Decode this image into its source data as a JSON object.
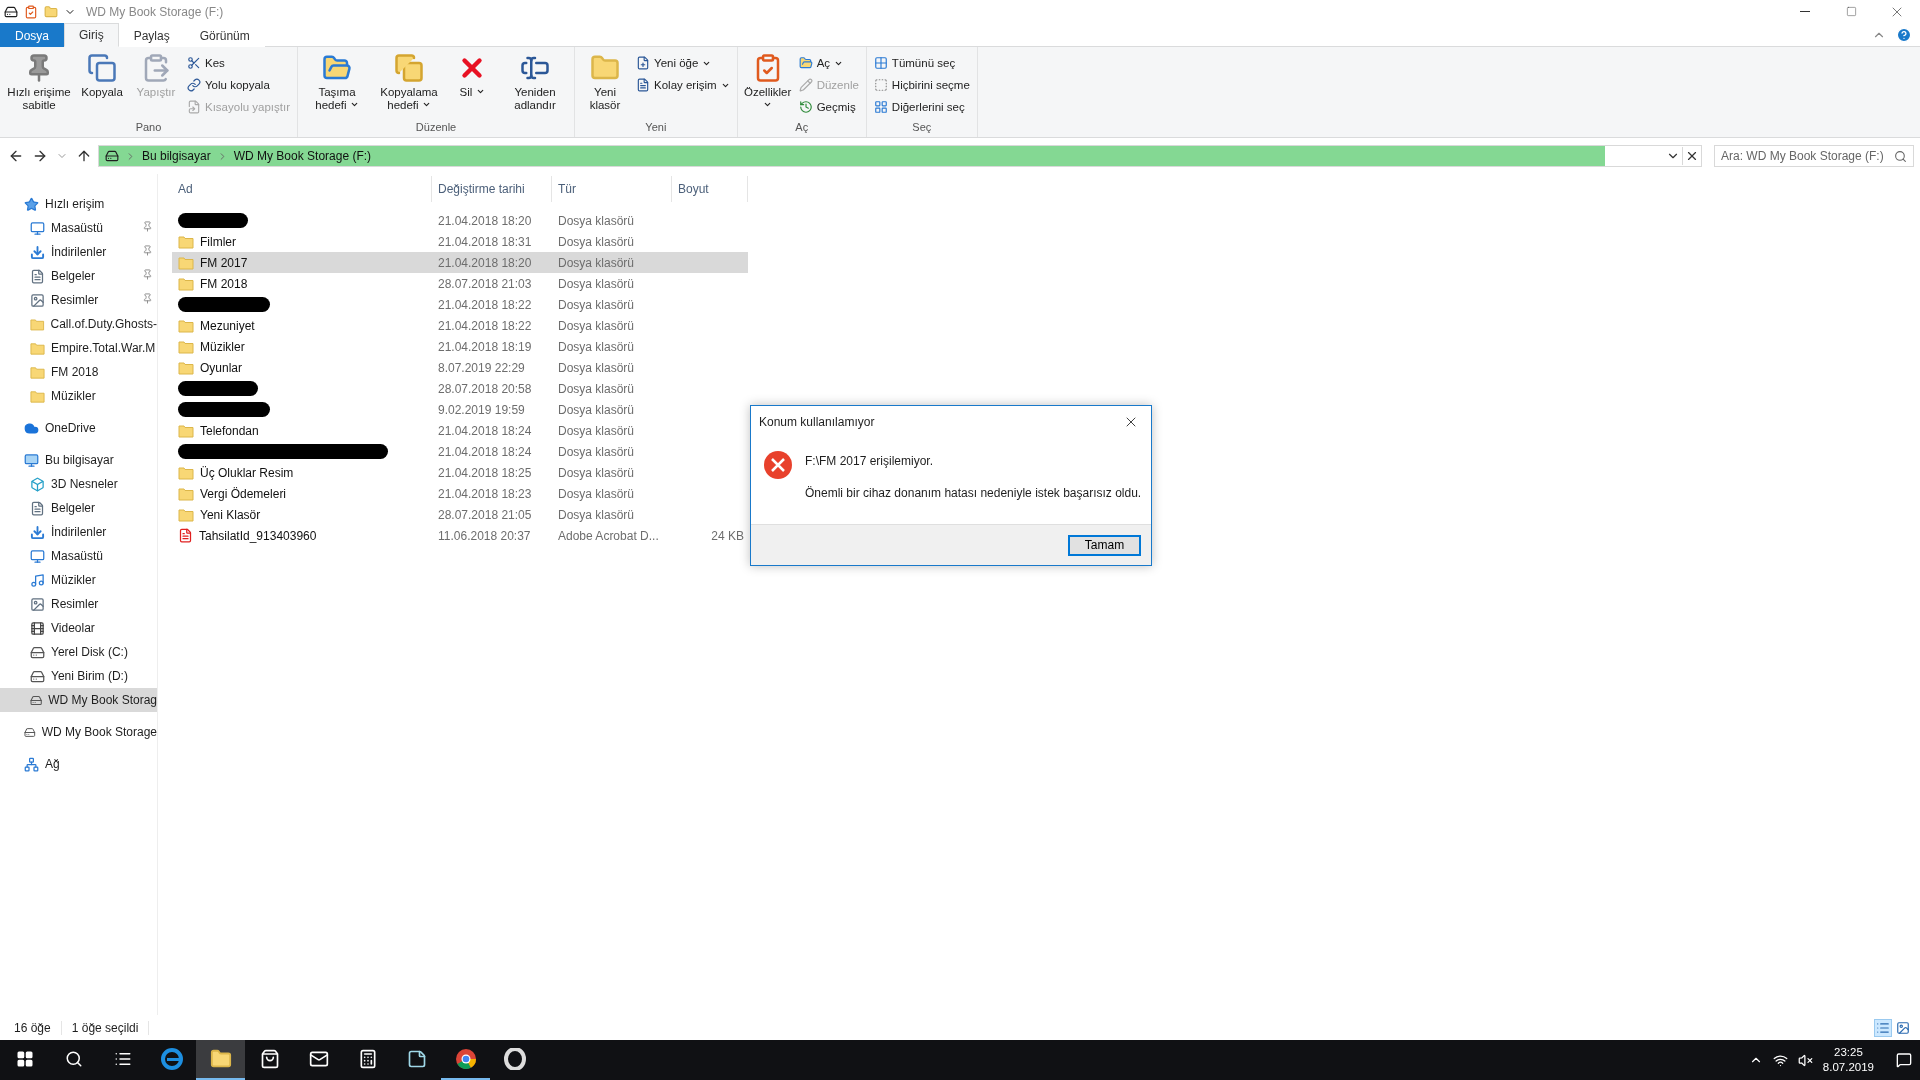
{
  "window": {
    "title": "WD My Book Storage (F:)"
  },
  "tabs": [
    {
      "label": "Dosya",
      "kind": "file",
      "selected": false
    },
    {
      "label": "Giriş",
      "kind": "tab",
      "selected": true
    },
    {
      "label": "Paylaş",
      "kind": "tab",
      "selected": false
    },
    {
      "label": "Görünüm",
      "kind": "tab",
      "selected": false
    }
  ],
  "ribbon": [
    {
      "name": "Pano",
      "items": [
        {
          "kind": "large",
          "label": "Hızlı erişime sabitle",
          "disabled": false
        },
        {
          "kind": "large",
          "label": "Kopyala",
          "disabled": false
        },
        {
          "kind": "large",
          "label": "Yapıştır",
          "disabled": true
        },
        {
          "kind": "stack",
          "items": [
            {
              "label": "Kes",
              "disabled": false
            },
            {
              "label": "Yolu kopyala",
              "disabled": false
            },
            {
              "label": "Kısayolu yapıştır",
              "disabled": true
            }
          ]
        }
      ]
    },
    {
      "name": "Düzenle",
      "items": [
        {
          "kind": "large",
          "label": "Taşıma hedefi",
          "dropdown": true,
          "disabled": false
        },
        {
          "kind": "large",
          "label": "Kopyalama hedefi",
          "dropdown": true,
          "disabled": false
        },
        {
          "kind": "large",
          "label": "Sil",
          "dropdown": true,
          "disabled": false
        },
        {
          "kind": "large",
          "label": "Yeniden adlandır",
          "disabled": false
        }
      ]
    },
    {
      "name": "Yeni",
      "items": [
        {
          "kind": "large",
          "label": "Yeni klasör",
          "disabled": false
        },
        {
          "kind": "stack",
          "items": [
            {
              "label": "Yeni öğe",
              "dropdown": true,
              "disabled": false
            },
            {
              "label": "Kolay erişim",
              "dropdown": true,
              "disabled": false
            }
          ]
        }
      ]
    },
    {
      "name": "Aç",
      "items": [
        {
          "kind": "large",
          "label": "Özellikler",
          "dropdown": true,
          "disabled": false
        },
        {
          "kind": "stack",
          "items": [
            {
              "label": "Aç",
              "dropdown": true,
              "disabled": false
            },
            {
              "label": "Düzenle",
              "disabled": true
            },
            {
              "label": "Geçmiş",
              "disabled": false
            }
          ]
        }
      ]
    },
    {
      "name": "Seç",
      "items": [
        {
          "kind": "stack",
          "items": [
            {
              "label": "Tümünü seç",
              "disabled": false
            },
            {
              "label": "Hiçbirini seçme",
              "disabled": false
            },
            {
              "label": "Diğerlerini seç",
              "disabled": false
            }
          ]
        }
      ]
    }
  ],
  "address": {
    "path": [
      "Bu bilgisayar",
      "WD My Book Storage (F:)"
    ],
    "level": 0.94
  },
  "search": {
    "placeholder": "Ara: WD My Book Storage (F:)"
  },
  "sidebar": [
    {
      "label": "Hızlı erişim",
      "kind": "star",
      "selected": false,
      "children": [
        {
          "label": "Masaüstü",
          "kind": "desktop",
          "pinned": true,
          "selected": false
        },
        {
          "label": "İndirilenler",
          "kind": "download",
          "pinned": true,
          "selected": false
        },
        {
          "label": "Belgeler",
          "kind": "doc",
          "pinned": true,
          "selected": false
        },
        {
          "label": "Resimler",
          "kind": "pictures",
          "pinned": true,
          "selected": false
        },
        {
          "label": "Call.of.Duty.Ghosts-",
          "kind": "folder",
          "pinned": false,
          "selected": false
        },
        {
          "label": "Empire.Total.War.M",
          "kind": "folder",
          "pinned": false,
          "selected": false
        },
        {
          "label": "FM 2018",
          "kind": "folder",
          "pinned": false,
          "selected": false
        },
        {
          "label": "Müzikler",
          "kind": "folder",
          "pinned": false,
          "selected": false
        }
      ]
    },
    {
      "label": "OneDrive",
      "kind": "cloud",
      "selected": false
    },
    {
      "label": "Bu bilgisayar",
      "kind": "pc",
      "selected": false,
      "children": [
        {
          "label": "3D Nesneler",
          "kind": "cube",
          "selected": false
        },
        {
          "label": "Belgeler",
          "kind": "doc",
          "selected": false
        },
        {
          "label": "İndirilenler",
          "kind": "download",
          "selected": false
        },
        {
          "label": "Masaüstü",
          "kind": "desktop",
          "selected": false
        },
        {
          "label": "Müzikler",
          "kind": "music",
          "selected": false
        },
        {
          "label": "Resimler",
          "kind": "pictures",
          "selected": false
        },
        {
          "label": "Videolar",
          "kind": "video",
          "selected": false
        },
        {
          "label": "Yerel Disk (C:)",
          "kind": "windisk",
          "selected": false
        },
        {
          "label": "Yeni Birim (D:)",
          "kind": "disk",
          "selected": false
        },
        {
          "label": "WD My Book Storag",
          "kind": "disk",
          "selected": true
        }
      ]
    },
    {
      "label": "WD My Book Storage",
      "kind": "disk",
      "selected": false
    },
    {
      "label": "Ağ",
      "kind": "network",
      "selected": false
    }
  ],
  "table": {
    "columns": [
      "Ad",
      "Değiştirme tarihi",
      "Tür",
      "Boyut"
    ],
    "rows": [
      {
        "kind": "redacted",
        "date": "21.04.2018 18:20",
        "type": "Dosya klasörü",
        "selected": false
      },
      {
        "kind": "folder",
        "name": "Filmler",
        "date": "21.04.2018 18:31",
        "type": "Dosya klasörü",
        "selected": false
      },
      {
        "kind": "folder",
        "name": "FM 2017",
        "date": "21.04.2018 18:20",
        "type": "Dosya klasörü",
        "selected": true
      },
      {
        "kind": "folder",
        "name": "FM 2018",
        "date": "28.07.2018 21:03",
        "type": "Dosya klasörü",
        "selected": false
      },
      {
        "kind": "redacted",
        "date": "21.04.2018 18:22",
        "type": "Dosya klasörü",
        "selected": false
      },
      {
        "kind": "folder",
        "name": "Mezuniyet",
        "date": "21.04.2018 18:22",
        "type": "Dosya klasörü",
        "selected": false
      },
      {
        "kind": "folder",
        "name": "Müzikler",
        "date": "21.04.2018 18:19",
        "type": "Dosya klasörü",
        "selected": false
      },
      {
        "kind": "folder",
        "name": "Oyunlar",
        "date": "8.07.2019 22:29",
        "type": "Dosya klasörü",
        "selected": false
      },
      {
        "kind": "redacted",
        "date": "28.07.2018 20:58",
        "type": "Dosya klasörü",
        "selected": false
      },
      {
        "kind": "redacted",
        "date": "9.02.2019 19:59",
        "type": "Dosya klasörü",
        "selected": false
      },
      {
        "kind": "folder",
        "name": "Telefondan",
        "date": "21.04.2018 18:24",
        "type": "Dosya klasörü",
        "selected": false
      },
      {
        "kind": "redacted",
        "date": "21.04.2018 18:24",
        "type": "Dosya klasörü",
        "selected": false
      },
      {
        "kind": "folder",
        "name": "Üç Oluklar Resim",
        "date": "21.04.2018 18:25",
        "type": "Dosya klasörü",
        "selected": false
      },
      {
        "kind": "folder",
        "name": "Vergi Ödemeleri",
        "date": "21.04.2018 18:23",
        "type": "Dosya klasörü",
        "selected": false
      },
      {
        "kind": "folder",
        "name": "Yeni Klasör",
        "date": "28.07.2018 21:05",
        "type": "Dosya klasörü",
        "selected": false
      },
      {
        "kind": "pdf",
        "name": "TahsilatId_913403960",
        "date": "11.06.2018 20:37",
        "type": "Adobe Acrobat D...",
        "size": "24 KB",
        "selected": false
      }
    ]
  },
  "status_bar": {
    "count": "16 öğe",
    "selection": "1 öğe seçildi"
  },
  "dialog": {
    "title": "Konum kullanılamıyor",
    "heading": "F:\\FM 2017 erişilemiyor.",
    "message": "Önemli bir cihaz donanım hatası nedeniyle istek başarısız oldu.",
    "button": "Tamam"
  },
  "taskbar": {
    "apps": [
      {
        "kind": "start",
        "selected": false
      },
      {
        "kind": "search",
        "selected": false
      },
      {
        "kind": "taskview",
        "selected": false
      },
      {
        "kind": "edge",
        "selected": false
      },
      {
        "kind": "explorer",
        "selected": true
      },
      {
        "kind": "store",
        "selected": false
      },
      {
        "kind": "mail",
        "selected": false
      },
      {
        "kind": "calculator",
        "selected": false
      },
      {
        "kind": "notes",
        "selected": false
      },
      {
        "kind": "chrome",
        "selected": false,
        "running": true
      },
      {
        "kind": "opera",
        "selected": false
      }
    ],
    "time": "23:25",
    "date": "8.07.2019"
  }
}
